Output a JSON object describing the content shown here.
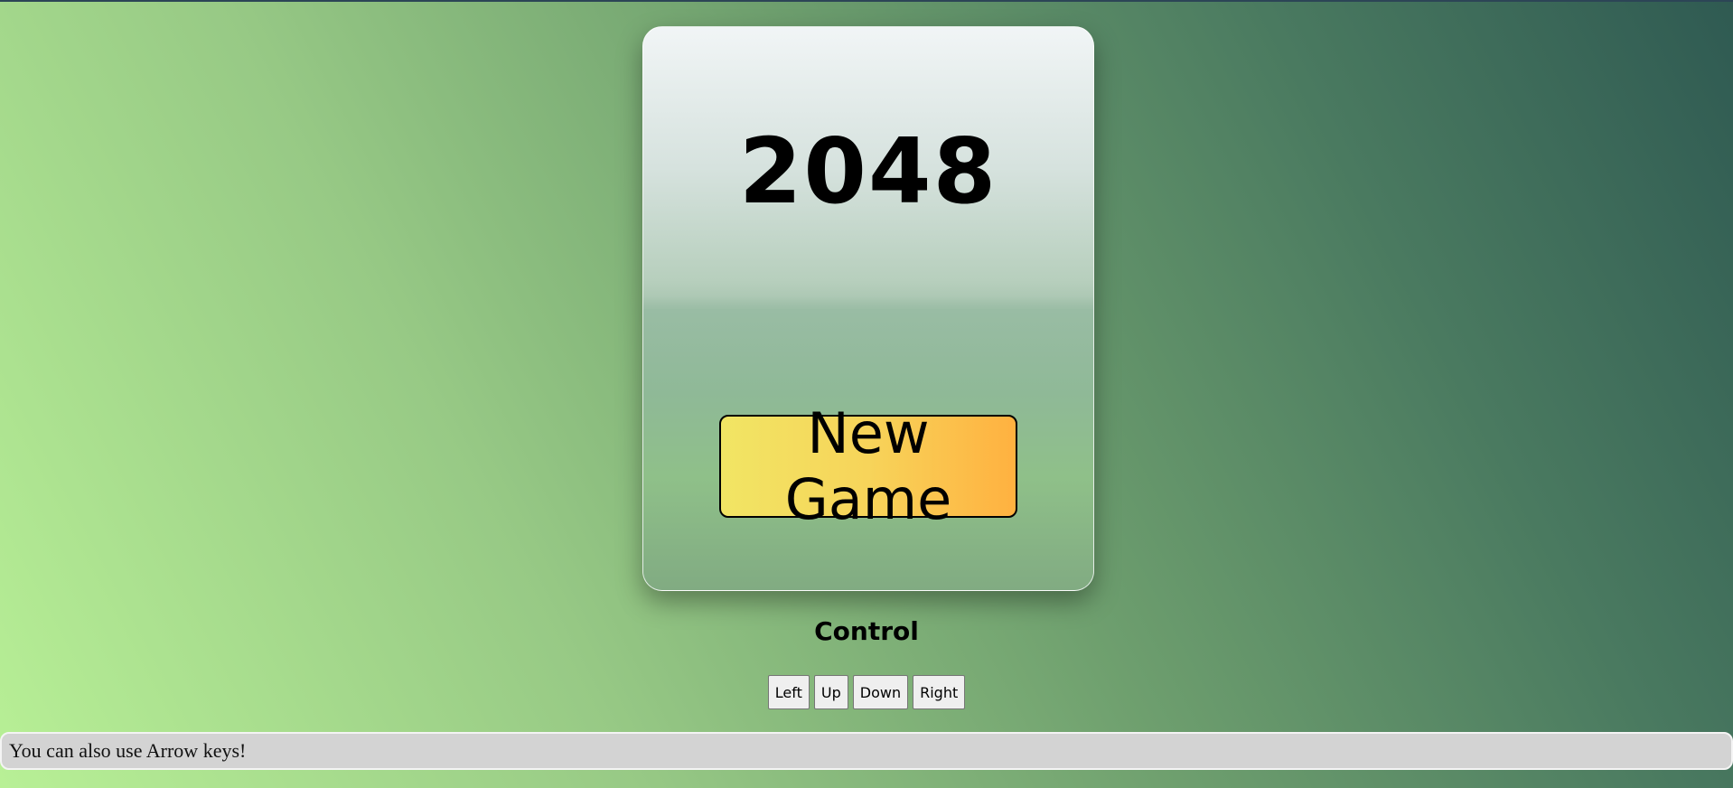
{
  "game": {
    "title": "2048",
    "new_game_label": "New Game"
  },
  "controls": {
    "heading": "Control",
    "buttons": [
      {
        "label": "Left"
      },
      {
        "label": "Up"
      },
      {
        "label": "Down"
      },
      {
        "label": "Right"
      }
    ]
  },
  "hint": {
    "text": "You can also use Arrow keys!"
  },
  "colors": {
    "button_gradient_start": "#f1e564",
    "button_gradient_end": "#ffb140",
    "page_gradient_light": "#b8f096",
    "page_gradient_dark": "#2f5a52"
  }
}
